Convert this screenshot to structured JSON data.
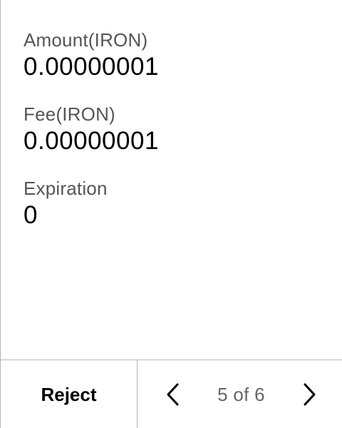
{
  "fields": [
    {
      "label": "Amount(IRON)",
      "value": "0.00000001"
    },
    {
      "label": "Fee(IRON)",
      "value": "0.00000001"
    },
    {
      "label": "Expiration",
      "value": "0"
    }
  ],
  "footer": {
    "reject_label": "Reject",
    "pager_text": "5 of 6",
    "prev_icon": "chevron-left-icon",
    "next_icon": "chevron-right-icon"
  }
}
